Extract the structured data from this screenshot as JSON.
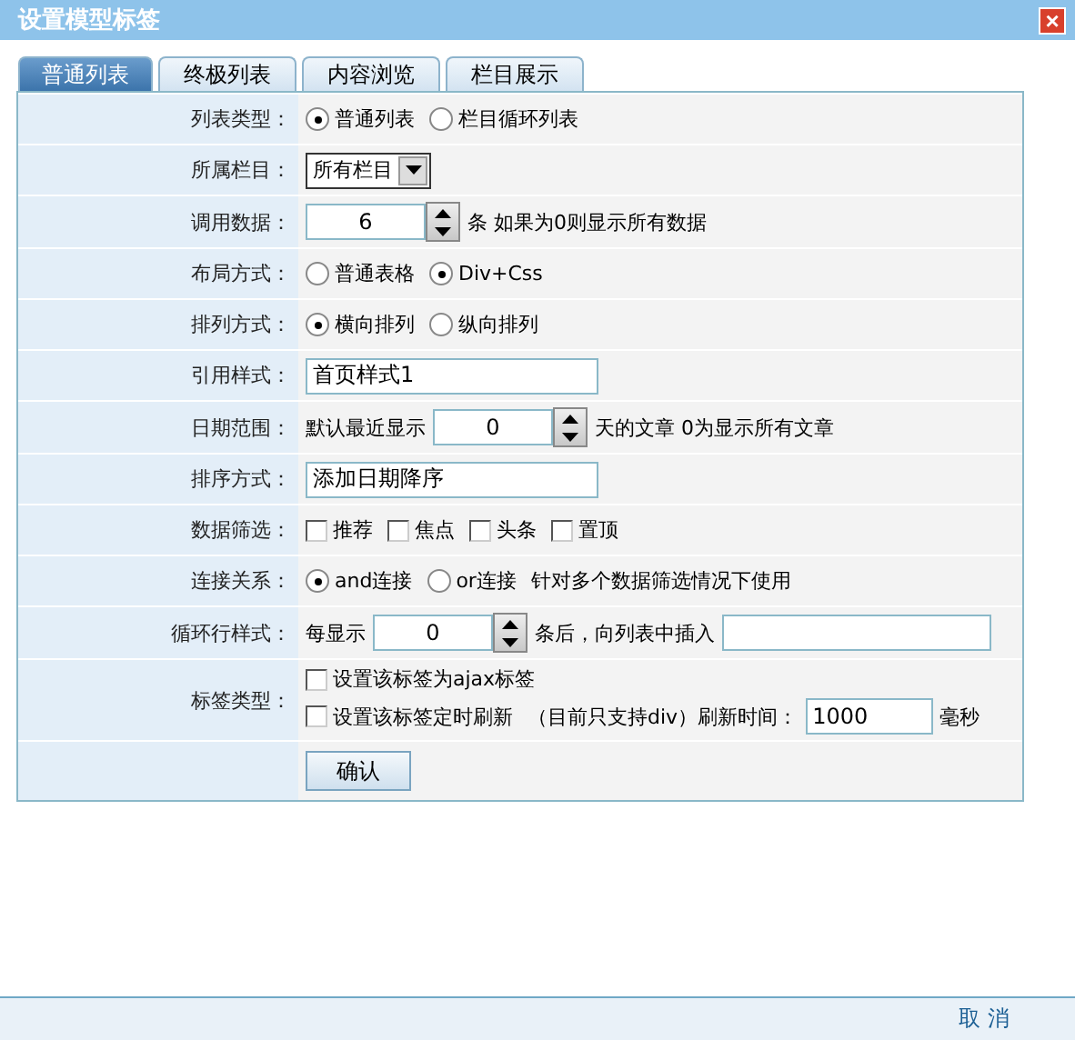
{
  "window": {
    "title": "设置模型标签",
    "close": "×"
  },
  "tabs": [
    {
      "label": "普通列表",
      "selected": true
    },
    {
      "label": "终极列表",
      "selected": false
    },
    {
      "label": "内容浏览",
      "selected": false
    },
    {
      "label": "栏目展示",
      "selected": false
    }
  ],
  "rows": [
    {
      "label": "列表类型：",
      "lines": [
        [
          {
            "kind": "radio",
            "label": "普通列表",
            "selected": true
          },
          {
            "kind": "radio",
            "label": "栏目循环列表",
            "selected": false
          }
        ]
      ]
    },
    {
      "label": "所属栏目：",
      "lines": [
        [
          {
            "kind": "select",
            "value": "所有栏目"
          }
        ]
      ]
    },
    {
      "label": "调用数据：",
      "lines": [
        [
          {
            "kind": "spinner",
            "value": "6"
          },
          {
            "kind": "note",
            "text": "条 如果为0则显示所有数据"
          }
        ]
      ]
    },
    {
      "label": "布局方式：",
      "lines": [
        [
          {
            "kind": "radio",
            "label": "普通表格",
            "selected": false
          },
          {
            "kind": "radio",
            "label": "Div+Css",
            "selected": true
          }
        ]
      ]
    },
    {
      "label": "排列方式：",
      "lines": [
        [
          {
            "kind": "radio",
            "label": "横向排列",
            "selected": true
          },
          {
            "kind": "radio",
            "label": "纵向排列",
            "selected": false
          }
        ]
      ]
    },
    {
      "label": "引用样式：",
      "lines": [
        [
          {
            "kind": "field",
            "value": "首页样式1"
          }
        ]
      ]
    },
    {
      "label": "日期范围：",
      "lines": [
        [
          {
            "kind": "note",
            "text": "默认最近显示"
          },
          {
            "kind": "spinner",
            "value": "0"
          },
          {
            "kind": "note",
            "text": "天的文章  0为显示所有文章"
          }
        ]
      ]
    },
    {
      "label": "排序方式：",
      "lines": [
        [
          {
            "kind": "field",
            "value": "添加日期降序"
          }
        ]
      ]
    },
    {
      "label": "数据筛选：",
      "lines": [
        [
          {
            "kind": "checkbox",
            "label": "推荐",
            "checked": false
          },
          {
            "kind": "checkbox",
            "label": "焦点",
            "checked": false
          },
          {
            "kind": "checkbox",
            "label": "头条",
            "checked": false
          },
          {
            "kind": "checkbox",
            "label": "置顶",
            "checked": false
          }
        ]
      ]
    },
    {
      "label": "连接关系：",
      "lines": [
        [
          {
            "kind": "radio",
            "label": "and连接",
            "selected": true
          },
          {
            "kind": "radio",
            "label": "or连接",
            "selected": false
          },
          {
            "kind": "note",
            "text": "针对多个数据筛选情况下使用"
          }
        ]
      ]
    },
    {
      "label": "循环行样式：",
      "lines": [
        [
          {
            "kind": "note",
            "text": "每显示"
          },
          {
            "kind": "spinner",
            "value": "0"
          },
          {
            "kind": "note",
            "text": "条后，向列表中插入"
          },
          {
            "kind": "blank_field"
          }
        ]
      ]
    },
    {
      "label": "标签类型：",
      "lines": [
        [
          {
            "kind": "checkbox",
            "label": "设置该标签为ajax标签",
            "checked": false
          }
        ],
        [
          {
            "kind": "checkbox",
            "label": "设置该标签定时刷新",
            "checked": false
          },
          {
            "kind": "note",
            "text": "（目前只支持div）刷新时间："
          },
          {
            "kind": "short_field",
            "value": "1000"
          },
          {
            "kind": "note",
            "text": "毫秒"
          }
        ]
      ]
    },
    {
      "label": "",
      "lines": [
        [
          {
            "kind": "button",
            "label": "确认"
          }
        ]
      ]
    }
  ],
  "footer": {
    "cancel": "取 消"
  }
}
